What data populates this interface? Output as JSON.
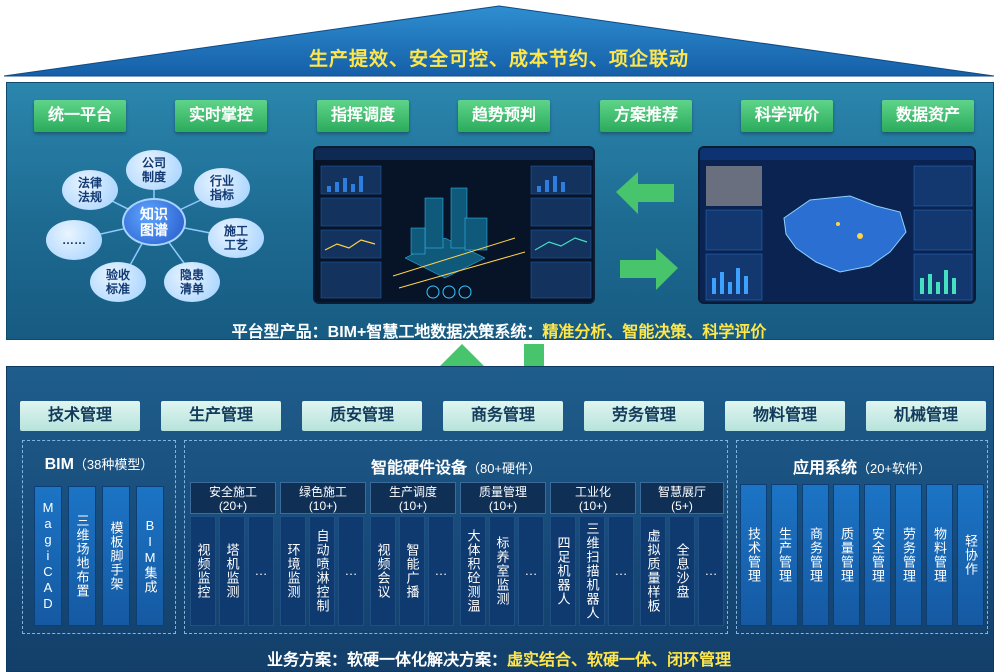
{
  "roof": {
    "title": "生产提效、安全可控、成本节约、项企联动"
  },
  "platform": {
    "features": [
      "统一平台",
      "实时掌控",
      "指挥调度",
      "趋势预判",
      "方案推荐",
      "科学评价",
      "数据资产"
    ],
    "knowledge_map": {
      "center": "知识\n图谱",
      "nodes": [
        "公司\n制度",
        "行业\n指标",
        "施工\n工艺",
        "隐患\n清单",
        "验收\n标准",
        "……",
        "法律\n法规"
      ]
    },
    "caption_main": "平台型产品：BIM+智慧工地数据决策系统：",
    "caption_highlight": "精准分析、智能决策、科学评价"
  },
  "management": [
    "技术管理",
    "生产管理",
    "质安管理",
    "商务管理",
    "劳务管理",
    "物料管理",
    "机械管理"
  ],
  "bim": {
    "title": "BIM",
    "subtitle": "（38种模型）",
    "items": [
      "MagiCAD",
      "三维场地布置",
      "模板脚手架",
      "BIM集成"
    ]
  },
  "hardware": {
    "title": "智能硬件设备",
    "subtitle": "（80+硬件）",
    "groups": [
      {
        "name": "安全施工",
        "count": "(20+)",
        "items": [
          "视频监控",
          "塔机监测",
          "…"
        ]
      },
      {
        "name": "绿色施工",
        "count": "(10+)",
        "items": [
          "环境监测",
          "自动喷淋控制",
          "…"
        ]
      },
      {
        "name": "生产调度",
        "count": "(10+)",
        "items": [
          "视频会议",
          "智能广播",
          "…"
        ]
      },
      {
        "name": "质量管理",
        "count": "(10+)",
        "items": [
          "大体积砼测温",
          "标养室监测",
          "…"
        ]
      },
      {
        "name": "工业化",
        "count": "(10+)",
        "items": [
          "四足机器人",
          "三维扫描机器人",
          "…"
        ]
      },
      {
        "name": "智慧展厅",
        "count": "(5+)",
        "items": [
          "虚拟质量样板",
          "全息沙盘",
          "…"
        ]
      }
    ]
  },
  "software": {
    "title": "应用系统",
    "subtitle": "（20+软件）",
    "items": [
      "技术管理",
      "生产管理",
      "商务管理",
      "质量管理",
      "安全管理",
      "劳务管理",
      "物料管理",
      "轻协作"
    ]
  },
  "bottom": {
    "caption_main": "业务方案：软硬一体化解决方案：",
    "caption_highlight": "虚实结合、软硬一体、闭环管理"
  },
  "colors": {
    "accent_yellow": "#ffe64a",
    "green": "#2bab5b",
    "platform_blue": "#1d6a91",
    "base_blue": "#174a78"
  }
}
